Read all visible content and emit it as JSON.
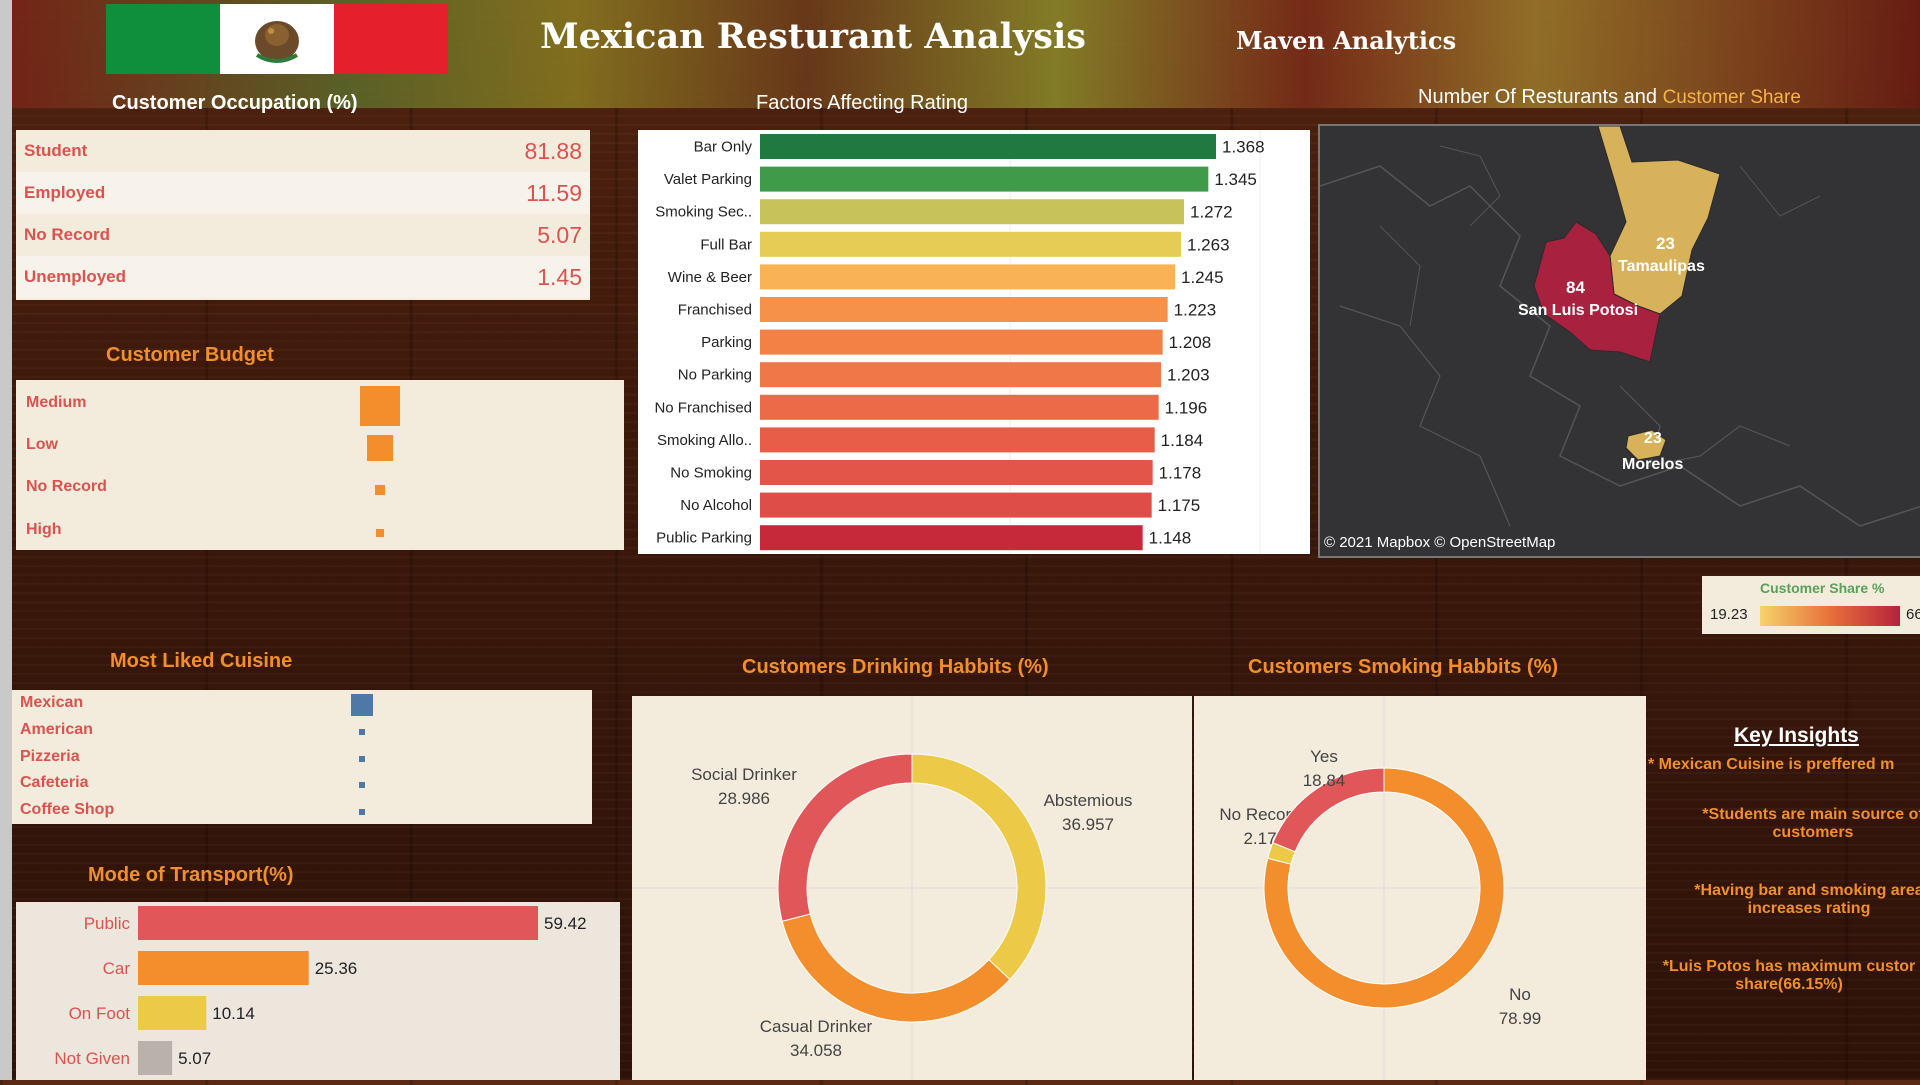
{
  "header": {
    "title": "Mexican Resturant Analysis",
    "brand": "Maven Analytics",
    "flag_colors": [
      "#0f8f3c",
      "#ffffff",
      "#e5202c"
    ]
  },
  "occupation": {
    "title": "Customer Occupation (%)",
    "rows": [
      {
        "label": "Student",
        "value": "81.88"
      },
      {
        "label": "Employed",
        "value": "11.59"
      },
      {
        "label": "No Record",
        "value": "5.07"
      },
      {
        "label": "Unemployed",
        "value": "1.45"
      }
    ]
  },
  "budget": {
    "title": "Customer Budget",
    "labels": [
      "Medium",
      "Low",
      "No Record",
      "High"
    ]
  },
  "cuisine": {
    "title": "Most Liked Cuisine",
    "labels": [
      "Mexican",
      "American",
      "Pizzeria",
      "Cafeteria",
      "Coffee Shop"
    ]
  },
  "transport_title": "Mode of Transport(%)",
  "factors_title": "Factors Affecting Rating",
  "map": {
    "title_a": "Number Of Resturants and ",
    "title_b": "Customer Share",
    "regions": [
      {
        "name": "Tamaulipas",
        "count": "23"
      },
      {
        "name": "San Luis Potosi",
        "count": "84"
      },
      {
        "name": "Morelos",
        "count": "23"
      }
    ],
    "attribution": "© 2021 Mapbox  © OpenStreetMap",
    "legend_title": "Customer Share %",
    "legend_min": "19.23",
    "legend_max": "66",
    "gradient": [
      "#f6d36a",
      "#e8703a",
      "#b5223c"
    ]
  },
  "drinking_title": "Customers Drinking Habbits (%)",
  "smoking_title": "Customers Smoking Habbits (%)",
  "insights": {
    "title": "Key Insights",
    "items": [
      "* Mexican Cuisine is preffered m",
      "*Students are main source of customers",
      "*Having bar and smoking area increases rating",
      "*Luis Potos has maximum custor share(66.15%)"
    ]
  },
  "chart_data": [
    {
      "type": "bar",
      "title": "Factors Affecting Rating",
      "orientation": "horizontal",
      "categories": [
        "Bar Only",
        "Valet Parking",
        "Smoking Sec..",
        "Full Bar",
        "Wine & Beer",
        "Franchised",
        "Parking",
        "No Parking",
        "No Franchised",
        "Smoking Allo..",
        "No Smoking",
        "No Alcohol",
        "Public Parking"
      ],
      "values": [
        1.368,
        1.345,
        1.272,
        1.263,
        1.245,
        1.223,
        1.208,
        1.203,
        1.196,
        1.184,
        1.178,
        1.175,
        1.148
      ],
      "value_labels": [
        "1.368",
        "1.345",
        "1.272",
        "1.263",
        "1.245",
        "1.223",
        "1.208",
        "1.203",
        "1.196",
        "1.184",
        "1.178",
        "1.175",
        "1.148"
      ],
      "colors": [
        "#1f7a3f",
        "#3f9a4a",
        "#c8c25a",
        "#e6cc55",
        "#f9b254",
        "#f6914a",
        "#f38146",
        "#f07748",
        "#ec6a48",
        "#e75d48",
        "#e35548",
        "#de4d48",
        "#c62a3a"
      ]
    },
    {
      "type": "bar",
      "title": "Mode of Transport(%)",
      "orientation": "horizontal",
      "categories": [
        "Public",
        "Car",
        "On Foot",
        "Not Given"
      ],
      "values": [
        59.42,
        25.36,
        10.14,
        5.07
      ],
      "value_labels": [
        "59.42",
        "25.36",
        "10.14",
        "5.07"
      ],
      "colors": [
        "#e15759",
        "#f28e2b",
        "#edc948",
        "#bab0ac"
      ]
    },
    {
      "type": "pie",
      "title": "Customers Drinking Habbits (%)",
      "categories": [
        "Abstemious",
        "Casual Drinker",
        "Social Drinker"
      ],
      "values": [
        36.957,
        34.058,
        28.986
      ],
      "value_labels": [
        "36.957",
        "34.058",
        "28.986"
      ],
      "colors": [
        "#edc948",
        "#f28e2b",
        "#e15759"
      ]
    },
    {
      "type": "pie",
      "title": "Customers Smoking Habbits (%)",
      "categories": [
        "No",
        "No Record",
        "Yes"
      ],
      "values": [
        78.99,
        2.17,
        18.84
      ],
      "value_labels": [
        "78.99",
        "2.17",
        "18.84"
      ],
      "colors": [
        "#f28e2b",
        "#edc948",
        "#e15759"
      ]
    },
    {
      "type": "scatter",
      "title": "Customer Budget",
      "categories": [
        "Medium",
        "Low",
        "No Record",
        "High"
      ],
      "values": [
        65,
        28,
        4,
        3
      ],
      "colors": [
        "#f28e2b"
      ]
    },
    {
      "type": "scatter",
      "title": "Most Liked Cuisine",
      "categories": [
        "Mexican",
        "American",
        "Pizzeria",
        "Cafeteria",
        "Coffee Shop"
      ],
      "values": [
        40,
        3,
        3,
        3,
        2
      ],
      "colors": [
        "#4e79a7"
      ]
    }
  ]
}
